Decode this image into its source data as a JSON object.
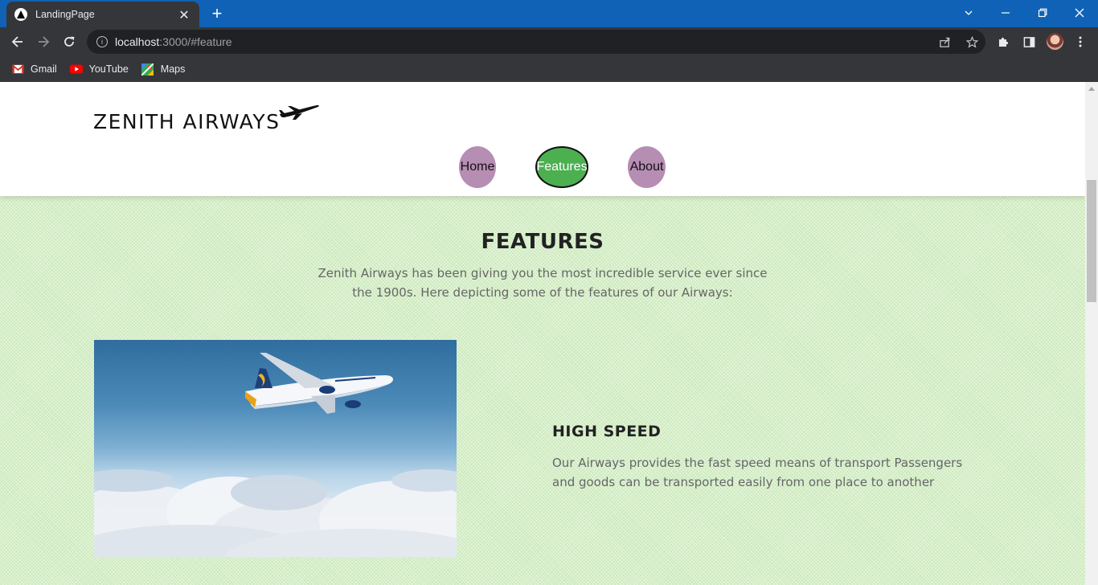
{
  "browser": {
    "tab_title": "LandingPage",
    "url_host": "localhost",
    "url_rest": ":3000/#feature",
    "bookmarks": [
      {
        "label": "Gmail",
        "icon": "gmail-icon"
      },
      {
        "label": "YouTube",
        "icon": "youtube-icon"
      },
      {
        "label": "Maps",
        "icon": "maps-icon"
      }
    ]
  },
  "site": {
    "brand": "ZENITH AIRWAYS",
    "nav": {
      "home": "Home",
      "features": "Features",
      "about": "About"
    },
    "colors": {
      "nav_pill": "#b68db3",
      "nav_active": "#4caf50",
      "section_bg": "#d6efc8"
    }
  },
  "features": {
    "title": "FEATURES",
    "subtitle": "Zenith Airways has been giving you the most incredible service ever since the 1900s. Here depicting some of the features of our Airways:",
    "items": [
      {
        "title": "HIGH SPEED",
        "text": "Our Airways provides the fast speed means of transport Passengers and goods can be transported easily from one place to another"
      }
    ]
  }
}
